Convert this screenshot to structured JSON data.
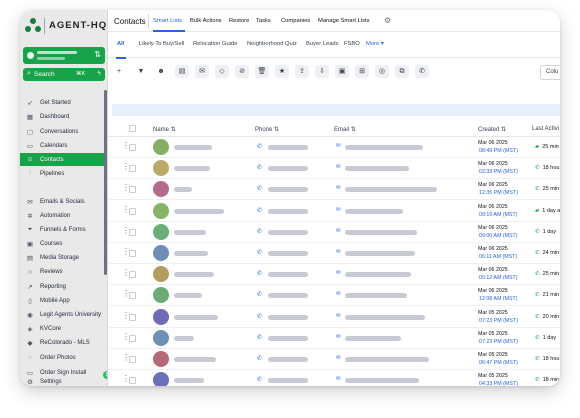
{
  "app": {
    "logo_text": "AGENT-HQ",
    "brand_color": "#16a34a",
    "accent_color": "#2563eb"
  },
  "sidebar": {
    "search_label": "Search",
    "search_shortcut": "⌘K",
    "items": [
      {
        "label": "Get Started",
        "icon": "rocket-icon"
      },
      {
        "label": "Dashboard",
        "icon": "dashboard-icon"
      },
      {
        "label": "Conversations",
        "icon": "chat-icon"
      },
      {
        "label": "Calendars",
        "icon": "calendar-icon"
      },
      {
        "label": "Contacts",
        "icon": "contacts-icon",
        "active": true
      },
      {
        "label": "Pipelines",
        "icon": "pipeline-icon"
      },
      {
        "label": "Emails & Socials",
        "icon": "mail-icon"
      },
      {
        "label": "Automation",
        "icon": "automation-icon"
      },
      {
        "label": "Funnels & Forms",
        "icon": "funnel-icon"
      },
      {
        "label": "Courses",
        "icon": "courses-icon"
      },
      {
        "label": "Media Storage",
        "icon": "media-icon"
      },
      {
        "label": "Reviews",
        "icon": "star-icon"
      },
      {
        "label": "Reporting",
        "icon": "reporting-icon"
      },
      {
        "label": "Mobile App",
        "icon": "mobile-icon"
      },
      {
        "label": "Legit Agents University",
        "icon": "university-icon"
      },
      {
        "label": "KVCore",
        "icon": "kvcore-icon"
      },
      {
        "label": "ReColorado - MLS",
        "icon": "mls-icon"
      },
      {
        "label": "Order Photos",
        "icon": "camera-icon"
      },
      {
        "label": "Order Sign Install",
        "icon": "sign-icon"
      },
      {
        "label": "Settings",
        "icon": "settings-icon"
      }
    ]
  },
  "header": {
    "title": "Contacts",
    "tabs": [
      "Smart Lists",
      "Bulk Actions",
      "Restore",
      "Tasks",
      "Companies",
      "Manage Smart Lists"
    ]
  },
  "smart_lists": {
    "tabs": [
      "All",
      "Likely To Buy/Sell",
      "Relocation Guide",
      "Neighborhood Quiz",
      "Buyer Leads",
      "FSBO"
    ],
    "more_label": "More ▾"
  },
  "toolbar": {
    "columns_label": "Colu"
  },
  "table": {
    "headers": {
      "name": "Name",
      "phone": "Phone",
      "email": "Email",
      "created": "Created",
      "last_activity": "Last Activi"
    },
    "rows": [
      {
        "avatar": "#84b063",
        "date": "Mar 06 2025",
        "time": "08:49 PM (MST)",
        "activity": "25 min",
        "act_icon": "sms"
      },
      {
        "avatar": "#b9ab66",
        "date": "Mar 06 2025",
        "time": "02:33 PM (MST)",
        "activity": "18 hou",
        "act_icon": "phone"
      },
      {
        "avatar": "#b56b8d",
        "date": "Mar 06 2025",
        "time": "12:35 PM (MST)",
        "activity": "25 min",
        "act_icon": "phone"
      },
      {
        "avatar": "#86b467",
        "date": "Mar 06 2025",
        "time": "09:19 AM (MST)",
        "activity": "1 day a",
        "act_icon": "sms"
      },
      {
        "avatar": "#6cae79",
        "date": "Mar 06 2025",
        "time": "09:00 AM (MST)",
        "activity": "1 day",
        "act_icon": "phone"
      },
      {
        "avatar": "#6d8fb5",
        "date": "Mar 06 2025",
        "time": "06:11 AM (MST)",
        "activity": "24 min",
        "act_icon": "phone"
      },
      {
        "avatar": "#b49b60",
        "date": "Mar 06 2025",
        "time": "05:12 AM (MST)",
        "activity": "25 min",
        "act_icon": "phone"
      },
      {
        "avatar": "#6aac74",
        "date": "Mar 06 2025",
        "time": "12:08 AM (MST)",
        "activity": "21 min",
        "act_icon": "phone"
      },
      {
        "avatar": "#6f6cb7",
        "date": "Mar 05 2025",
        "time": "07:23 PM (MST)",
        "activity": "20 min",
        "act_icon": "phone"
      },
      {
        "avatar": "#6b92b5",
        "date": "Mar 05 2025",
        "time": "07:23 PM (MST)",
        "activity": "1 day",
        "act_icon": "phone"
      },
      {
        "avatar": "#b56a76",
        "date": "Mar 05 2025",
        "time": "06:47 PM (MST)",
        "activity": "18 hou",
        "act_icon": "phone"
      },
      {
        "avatar": "#6c70b8",
        "date": "Mar 05 2025",
        "time": "04:33 PM (MST)",
        "activity": "18 min",
        "act_icon": "phone"
      }
    ]
  }
}
